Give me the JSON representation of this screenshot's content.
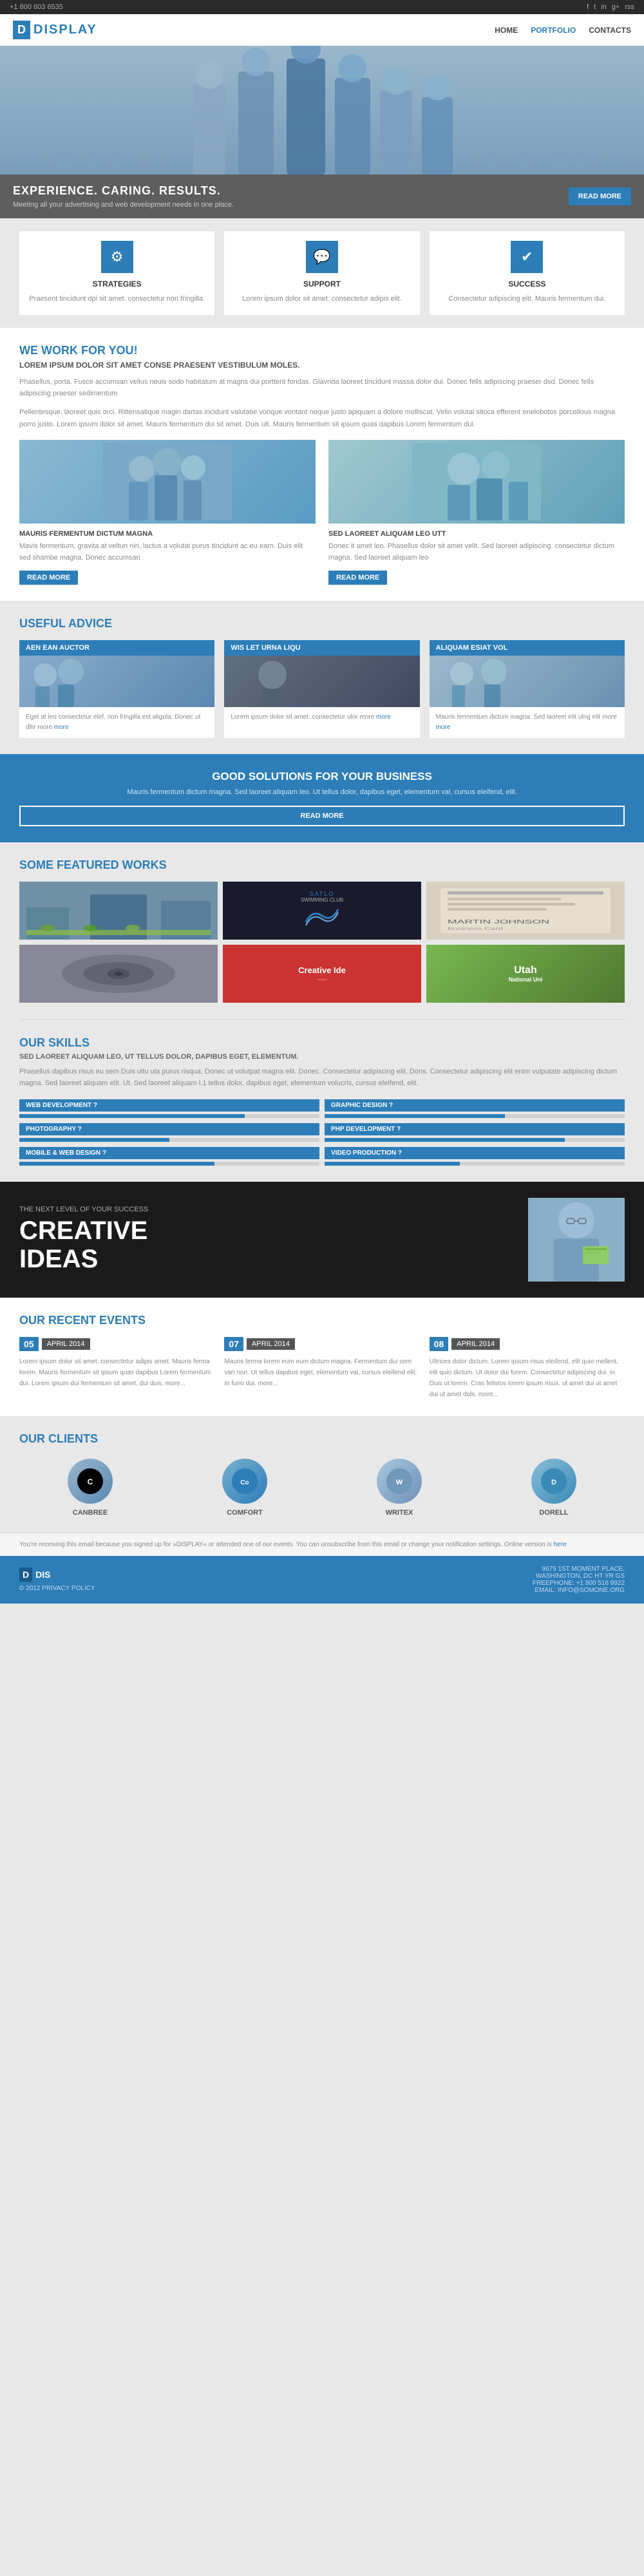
{
  "topbar": {
    "phone": "+1 800 603 6535",
    "social": [
      "f",
      "t",
      "in",
      "g+",
      "rss"
    ]
  },
  "header": {
    "logo_box": "D",
    "logo_text": "DISPLAY",
    "nav": [
      {
        "label": "HOME",
        "active": true
      },
      {
        "label": "PORTFOLIO",
        "active": false
      },
      {
        "label": "CONTACTS",
        "active": false
      }
    ]
  },
  "hero": {
    "title": "EXPERIENCE. CARING. RESULTS.",
    "subtitle": "Meeting all your advertising and web development needs in one place.",
    "button": "READ MORE"
  },
  "features": [
    {
      "icon": "⚙",
      "title": "STRATEGIES",
      "desc": "Praesent tincidunt dpi sit amet. consectetur non fringilla."
    },
    {
      "icon": "💬",
      "title": "SUPPORT",
      "desc": "Lorem ipsum dolor sit amet. consectetur adipis elit."
    },
    {
      "icon": "✔",
      "title": "SUCCESS",
      "desc": "Consectetur adipiscing elit. Mauris fermentum dui."
    }
  ],
  "we_work": {
    "title": "WE WORK FOR YOU!",
    "lorem_heading": "LOREM IPSUM DOLOR SIT AMET CONSE PRAESENT VESTIBULUM MOLES.",
    "para1": "Phasellus, porta. Fusce accumsan velius neuis sodo habitatum at magns dui porttent fondas. Glavrida laoreet tincidunt massa dolor dui. Donec fells adipiscing praeser dsd. Donec fells adipiscing praeser sedimentum",
    "para2": "Pellentesque, laoreet quis orci. Rittensatique magin dartas incidunt valutatie vonque vontant neque justo apiquam a dolore molliscat. Velio volutal sitoca efferent enelobotos porcellous magna porro justo. Lorem ipsum dolor sit amet. Mauris fermentum dui sit amet. Duis ult. Mauris fermentum sit ipsum quas dapibus Lorem fermentum dui.",
    "col_left": {
      "title": "MAURIS FERMENTUM DICTUM MAGNA",
      "text": "Mavis fermentum, gravita at veltun nin, lactus a volutat purus tincidunt ac eu earn. Duis elit sed shambe magna. Donec accumsan",
      "button": "READ MORE"
    },
    "col_right": {
      "title": "SED LAOREET ALIQUAM LEO UTT",
      "text": "Donec it amet leo. Phasellus dolor sit amet velit. Sed laoreet adipiscing. consectetur dictum magna. Sed laoreet aliquam leo",
      "button": "READ MORE"
    }
  },
  "useful_advice": {
    "title": "USEFUL ADVICE",
    "cards": [
      {
        "header": "AEN EAN AUCTOR",
        "text": "Eget at leo consectetur elef. non fringilla est aligula. Donec ut dllir more",
        "more": "more"
      },
      {
        "header": "WIS LET URNA LIQU",
        "text": "Lorem ipsum dolor sit amet. consectetur ulor more",
        "more": "more"
      },
      {
        "header": "ALIQUAM ESIAT VOL",
        "text": "Mauris fermentum dictum magna. Sed laoreet elit ulng elit more",
        "more": "more"
      }
    ]
  },
  "good_solutions": {
    "title": "GOOD SOLUTIONS FOR YOUR BUSINESS",
    "text": "Mauris fermentum dictum magna. Sed laoreet aliquam leo. Ut tellus dolor, dapibus eget, elementum val, cursus eleifend, elit.",
    "button": "READ MORE"
  },
  "featured_works": {
    "title": "SOME FEATURED WORKS",
    "works": [
      {
        "label": "",
        "type": 1
      },
      {
        "label": "SATLO SWIMMING CLUB",
        "type": 2
      },
      {
        "label": "MARTIN JOHNSON",
        "type": 3
      },
      {
        "label": "",
        "type": 4
      },
      {
        "label": "Creative Ide...",
        "type": 5
      },
      {
        "label": "Utah National Uni",
        "type": 6
      }
    ]
  },
  "skills": {
    "title": "OUR SKILLS",
    "subtitle": "SED LAOREET ALIQUAM LEO, UT TELLUS DOLOR, DAPIBUS EGET, ELEMENTUM.",
    "text": "Phasellus dapibus risus eu sem Duis ultu ula purus risqua. Donec ut volutpat magna elit. Donec. Consectetur adipiscing elit. Dons. Consectetur adipiscing elit enim vulputate adipiscing dictum magna. Sed laoreet aliquam elit. Ut. Sed laoreet aliquam l.1 tellus dolor, dapibus eget, elementum volucris, cursus eleifend, elit.",
    "bars": [
      {
        "label": "WEB DEVELOPMENT ?",
        "value": 75,
        "col": 1
      },
      {
        "label": "GRAPHIC DESIGN ?",
        "value": 60,
        "col": 2
      },
      {
        "label": "PHOTOGRAPHY ?",
        "value": 50,
        "col": 1
      },
      {
        "label": "PHP DEVELOPMENT ?",
        "value": 80,
        "col": 2
      },
      {
        "label": "MOBILE & WEB DESIGN ?",
        "value": 65,
        "col": 1
      },
      {
        "label": "VIDEO PRODUCTION ?",
        "value": 45,
        "col": 2
      }
    ]
  },
  "creative": {
    "top_label": "THE NEXT LEVEL OF YOUR SUCCESS",
    "title_line1": "CREATIVE",
    "title_line2": "IDEAS"
  },
  "recent_events": {
    "title": "OUR RECENT EVENTS",
    "events": [
      {
        "day": "05",
        "month": "APRIL 2014",
        "text": "Lorem ipsum dolor sit amet. consectetur adipis amet. Mauris ferma lorem. Mauris fermentum sit ipsum quas dapibus Lorem fermentum dui. Lorem ipsum dui fermentum sit amet. dui duis. more..."
      },
      {
        "day": "07",
        "month": "APRIL 2014",
        "text": "Mauris ferma lorem eum eum dictum magna. Fermentum dui sem vari non. Ut tellus dapibus eget, elementum val, cursus eleifend elit. In furio dui. more..."
      },
      {
        "day": "08",
        "month": "APRIL 2014",
        "text": "Ultrices dolor dictum. Lorem ipsum risus eleifend, elit quio mellent, elit quio dictum. Ut dolor dui furem. Consectetur adipiscing dui. in. Duis ut lorem. Cras felistos lorem ipsum risus. ut amet dui ut amet dui ut amet dols. more..."
      }
    ]
  },
  "clients": {
    "title": "OUR CLIENTS",
    "items": [
      {
        "name": "CANBREE",
        "initials": "C"
      },
      {
        "name": "COMFORT",
        "initials": "Co"
      },
      {
        "name": "WRITEX",
        "initials": "W"
      },
      {
        "name": "DORELL",
        "initials": "D"
      }
    ]
  },
  "newsletter": {
    "text": "You're receiving this email because you signed up for »DISPLAY« or attended one of our events. You can unsubscribe from this email or change your notification settings. Online version is",
    "link": "here"
  },
  "footer": {
    "logo_box": "D",
    "logo_text": "DIS",
    "copyright": "© 2012 PRIVACY POLICY",
    "address_line1": "9675 1ST MOMENT PLACE,",
    "address_line2": "WASHINGTON, DC HT YR GS",
    "phone": "FREEPHONE: +1 800 516 9922",
    "email": "EMAIL: INFO@SOMONE.ORG"
  }
}
